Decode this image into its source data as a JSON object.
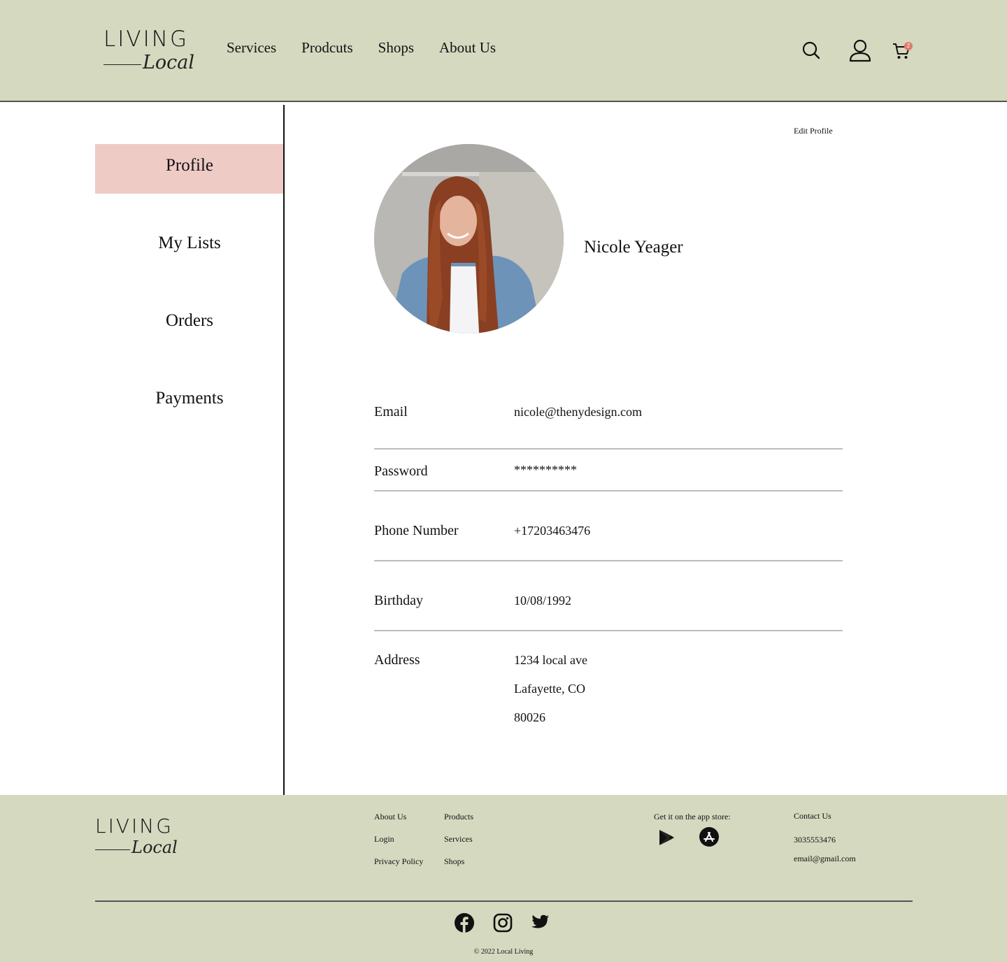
{
  "brand": {
    "logo_word": "LIVING",
    "logo_script": "Local"
  },
  "nav": {
    "items": [
      "Services",
      "Prodcuts",
      "Shops",
      "About Us"
    ]
  },
  "header_icons": {
    "search": "search-icon",
    "account": "user-icon",
    "cart": "cart-icon",
    "cart_count": "2"
  },
  "colors": {
    "header_bg": "#d5d9bf",
    "active_tab": "#efcbc6",
    "badge": "#e07a6a"
  },
  "sidebar": {
    "items": [
      {
        "label": "Profile",
        "active": true
      },
      {
        "label": "My Lists",
        "active": false
      },
      {
        "label": "Orders",
        "active": false
      },
      {
        "label": "Payments",
        "active": false
      }
    ]
  },
  "profile": {
    "edit_label": "Edit Profile",
    "name": "Nicole Yeager",
    "fields": {
      "email": {
        "label": "Email",
        "value": "nicole@thenydesign.com"
      },
      "password": {
        "label": "Password",
        "value": "**********"
      },
      "phone": {
        "label": "Phone Number",
        "value": "+17203463476"
      },
      "birthday": {
        "label": "Birthday",
        "value": "10/08/1992"
      },
      "address": {
        "label": "Address",
        "line1": "1234 local ave",
        "line2": "Lafayette, CO",
        "line3": "80026"
      }
    }
  },
  "footer": {
    "links_col1": [
      "About Us",
      "Login",
      "Privacy Policy"
    ],
    "links_col2": [
      "Products",
      "Services",
      "Shops"
    ],
    "app_store_label": "Get it on the app store:",
    "contact": {
      "title": "Contact Us",
      "phone": "3035553476",
      "email": "email@gmail.com"
    },
    "social": [
      "facebook-icon",
      "instagram-icon",
      "twitter-icon"
    ],
    "copyright": "2022 Local Living"
  }
}
